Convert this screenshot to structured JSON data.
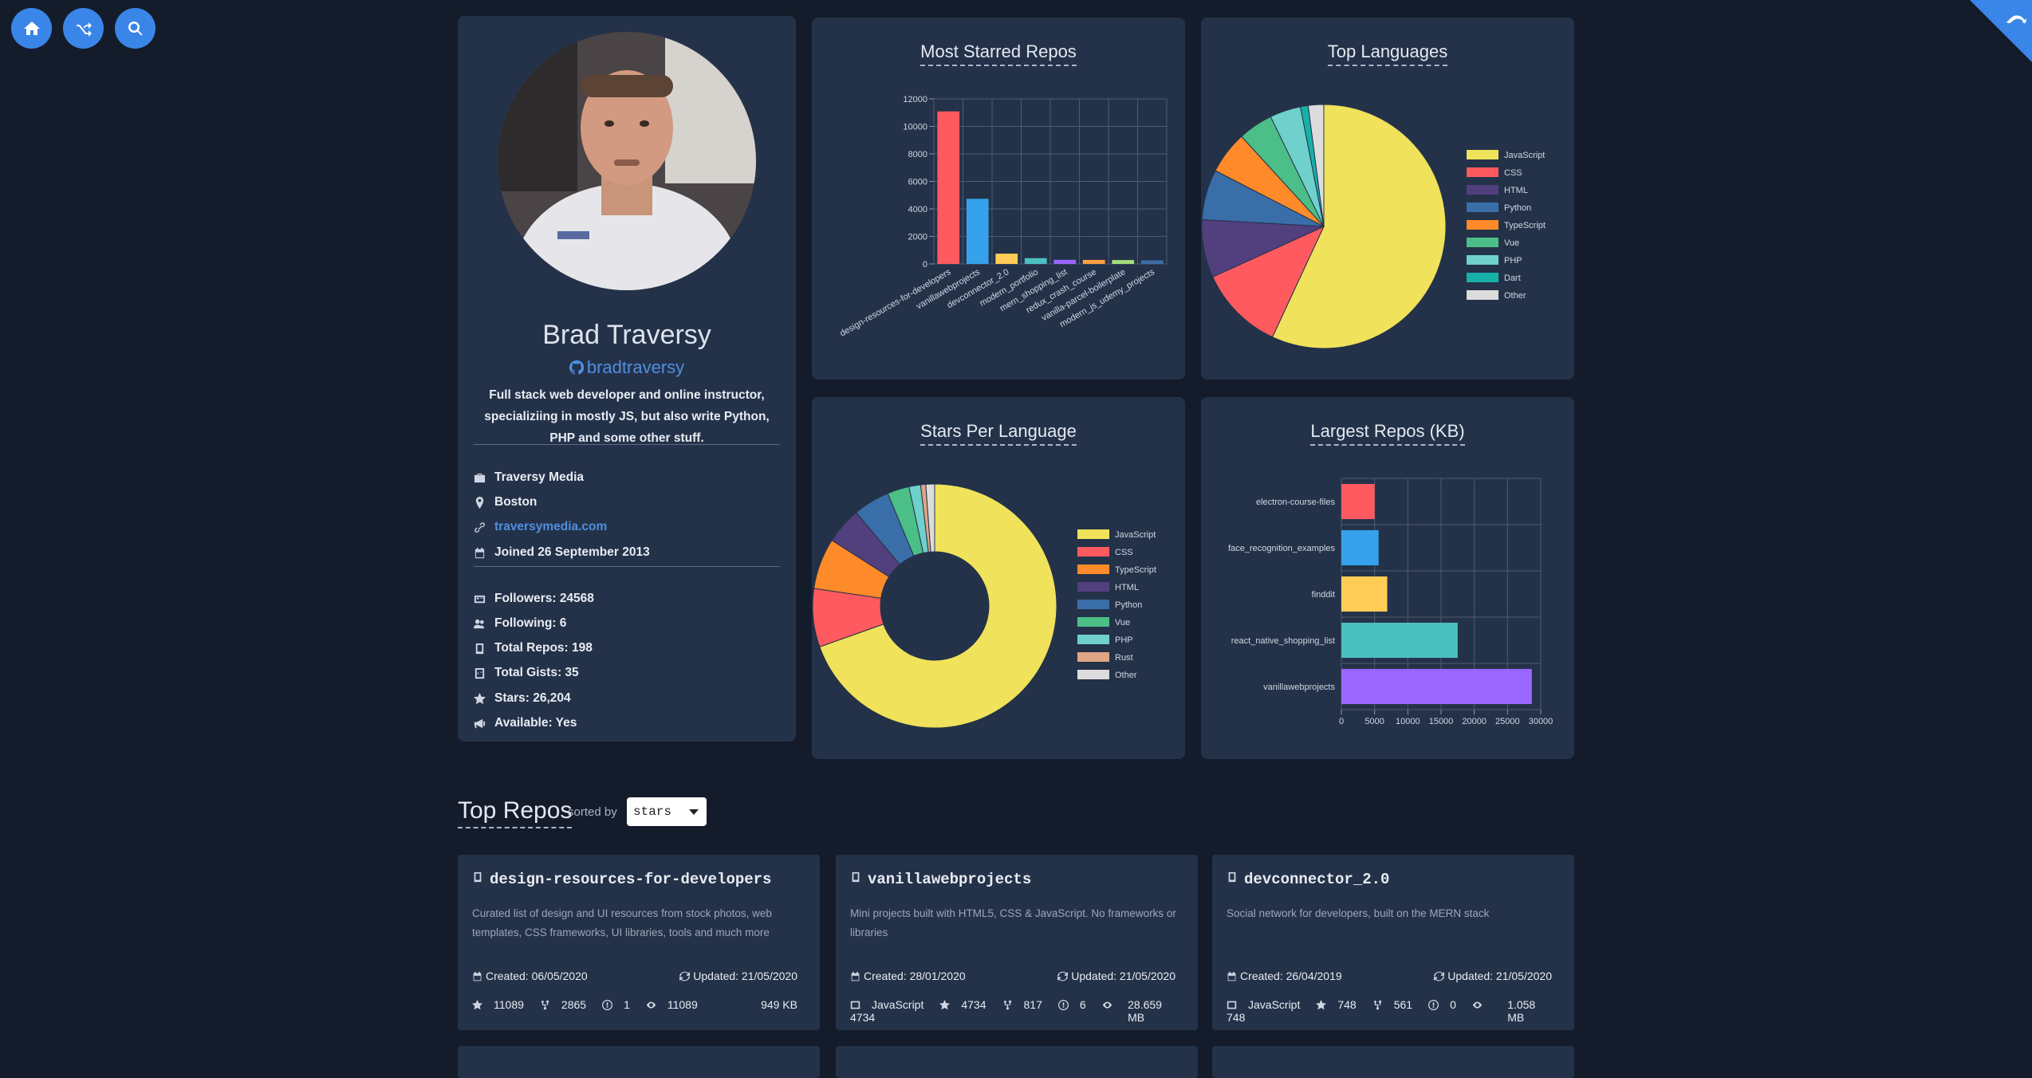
{
  "nav": {
    "buttons": [
      "home-icon",
      "shuffle-icon",
      "search-icon"
    ],
    "corner": "github-corner-icon"
  },
  "profile": {
    "name": "Brad Traversy",
    "login": "bradtraversy",
    "bio": "Full stack web developer and online instructor, specializiing in mostly JS, but also write Python, PHP and some other stuff.",
    "company": "Traversy Media",
    "location": "Boston",
    "blog": "traversymedia.com",
    "joined": "Joined 26 September 2013",
    "followers": "Followers: 24568",
    "following": "Following: 6",
    "repos": "Total Repos: 198",
    "gists": "Total Gists: 35",
    "stars": "Stars: 26,204",
    "available": "Available: Yes"
  },
  "chart_data": [
    {
      "type": "bar",
      "title": "Most Starred Repos",
      "categories": [
        "design-resources-for-developers",
        "vanillawebprojects",
        "devconnector_2.0",
        "modern_portfolio",
        "mern_shopping_list",
        "redux_crash_course",
        "vanilla-parcel-boilerplate",
        "modern_js_udemy_projects"
      ],
      "values": [
        11089,
        4734,
        748,
        420,
        300,
        290,
        280,
        260
      ],
      "colors": [
        "#ff5a5f",
        "#36a2eb",
        "#ffcd56",
        "#4bc0c0",
        "#9966ff",
        "#ff9f40",
        "#a3e07a",
        "#3d6fa8"
      ],
      "yticks": [
        0,
        2000,
        4000,
        6000,
        8000,
        10000,
        12000
      ],
      "ylim": [
        0,
        12000
      ]
    },
    {
      "type": "pie",
      "title": "Top Languages",
      "labels": [
        "JavaScript",
        "CSS",
        "HTML",
        "Python",
        "TypeScript",
        "Vue",
        "PHP",
        "Dart",
        "Other"
      ],
      "values": [
        111,
        22,
        15,
        13,
        11,
        9,
        8,
        2,
        4
      ],
      "colors": [
        "#f0e25a",
        "#ff5a5f",
        "#523f7e",
        "#3a6ea8",
        "#ff8a2a",
        "#4bbf87",
        "#6fd0cc",
        "#17b0a8",
        "#dcdcdc"
      ]
    },
    {
      "type": "pie",
      "title": "Stars Per Language",
      "labels": [
        "JavaScript",
        "CSS",
        "TypeScript",
        "HTML",
        "Python",
        "Vue",
        "PHP",
        "Rust",
        "Other"
      ],
      "values": [
        72,
        8,
        7,
        5,
        5,
        3,
        1.6,
        0.7,
        1.2
      ],
      "colors": [
        "#f0e25a",
        "#ff5a5f",
        "#ff8a2a",
        "#523f7e",
        "#3a6ea8",
        "#4bbf87",
        "#6fd0cc",
        "#e0a584",
        "#dcdcdc"
      ]
    },
    {
      "type": "bar",
      "title": "Largest Repos (KB)",
      "categories": [
        "electron-course-files",
        "face_recognition_examples",
        "finddit",
        "react_native_shopping_list",
        "vanillawebprojects"
      ],
      "values": [
        5000,
        5600,
        6900,
        17500,
        28659
      ],
      "colors": [
        "#ff5a5f",
        "#36a2eb",
        "#ffcd56",
        "#4bc0c0",
        "#9966ff"
      ],
      "xticks": [
        0,
        5000,
        10000,
        15000,
        20000,
        25000,
        30000
      ],
      "xlim": [
        0,
        30000
      ]
    }
  ],
  "top_repos": {
    "title": "Top Repos",
    "sorted_by": "sorted by",
    "sort_value": "stars",
    "repos": [
      {
        "name": "design-resources-for-developers",
        "desc": "Curated list of design and UI resources from stock photos, web templates, CSS frameworks, UI libraries, tools and much more",
        "created": "Created: 06/05/2020",
        "updated": "Updated: 21/05/2020",
        "language": "",
        "stars": "11089",
        "forks": "2865",
        "issues": "1",
        "watchers": "11089",
        "size": "949 KB"
      },
      {
        "name": "vanillawebprojects",
        "desc": "Mini projects built with HTML5, CSS & JavaScript. No frameworks or libraries",
        "created": "Created: 28/01/2020",
        "updated": "Updated: 21/05/2020",
        "language": "JavaScript",
        "stars": "4734",
        "forks": "817",
        "issues": "6",
        "watchers": "4734",
        "size": "28.659 MB"
      },
      {
        "name": "devconnector_2.0",
        "desc": "Social network for developers, built on the MERN stack",
        "created": "Created: 26/04/2019",
        "updated": "Updated: 21/05/2020",
        "language": "JavaScript",
        "stars": "748",
        "forks": "561",
        "issues": "0",
        "watchers": "748",
        "size": "1.058 MB"
      }
    ]
  }
}
